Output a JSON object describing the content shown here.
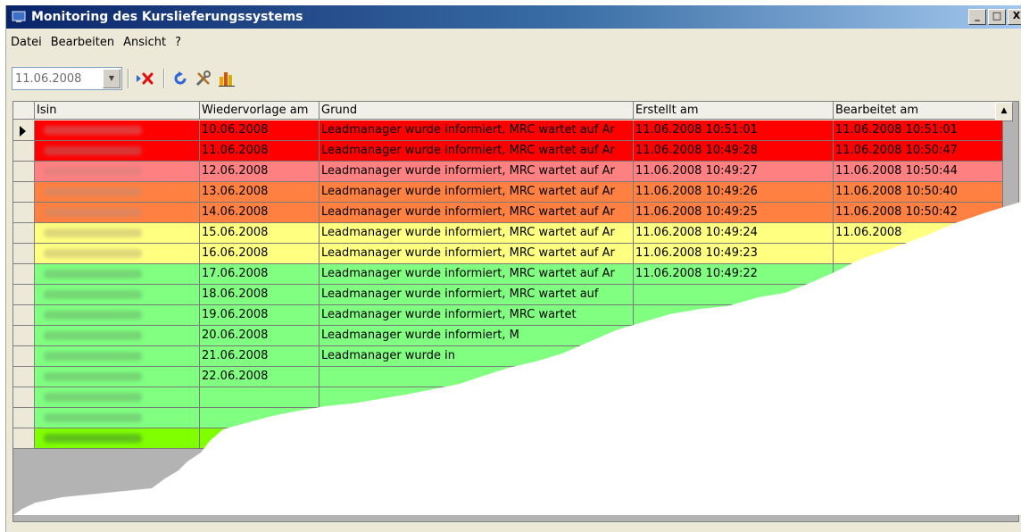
{
  "window": {
    "title": "Monitoring des Kurslieferungssystems",
    "buttons": [
      "_",
      "□",
      "X"
    ]
  },
  "menu": {
    "items": [
      "Datei",
      "Bearbeiten",
      "Ansicht",
      "?"
    ]
  },
  "toolbar": {
    "date_value": "11.06.2008",
    "icons": [
      "delete-red-x-icon",
      "refresh-icon",
      "tools-icon",
      "chart-icon"
    ]
  },
  "grid": {
    "columns": [
      "Isin",
      "Wiedervorlage am",
      "Grund",
      "Erstellt am",
      "Bearbeitet am"
    ],
    "rows": [
      {
        "color": "#ff0000",
        "blur": "#e33a3a",
        "wiedervorlage": "10.06.2008",
        "grund": "Leadmanager wurde informiert, MRC wartet auf Ar",
        "erstellt": "11.06.2008 10:51:01",
        "bearbeitet": "11.06.2008 10:51:01"
      },
      {
        "color": "#ff0000",
        "blur": "#d93636",
        "wiedervorlage": "11.06.2008",
        "grund": "Leadmanager wurde informiert, MRC wartet auf Ar",
        "erstellt": "11.06.2008 10:49:28",
        "bearbeitet": "11.06.2008 10:50:47"
      },
      {
        "color": "#ff8080",
        "blur": "#e88080",
        "wiedervorlage": "12.06.2008",
        "grund": "Leadmanager wurde informiert, MRC wartet auf Ar",
        "erstellt": "11.06.2008 10:49:27",
        "bearbeitet": "11.06.2008 10:50:44"
      },
      {
        "color": "#ff8040",
        "blur": "#e0845a",
        "wiedervorlage": "13.06.2008",
        "grund": "Leadmanager wurde informiert, MRC wartet auf Ar",
        "erstellt": "11.06.2008 10:49:26",
        "bearbeitet": "11.06.2008 10:50:40"
      },
      {
        "color": "#ff8040",
        "blur": "#e0845a",
        "wiedervorlage": "14.06.2008",
        "grund": "Leadmanager wurde informiert, MRC wartet auf Ar",
        "erstellt": "11.06.2008 10:49:25",
        "bearbeitet": "11.06.2008 10:50:42"
      },
      {
        "color": "#ffff80",
        "blur": "#ddd87a",
        "wiedervorlage": "15.06.2008",
        "grund": "Leadmanager wurde informiert, MRC wartet auf Ar",
        "erstellt": "11.06.2008 10:49:24",
        "bearbeitet": "11.06.2008"
      },
      {
        "color": "#ffff80",
        "blur": "#ddd87a",
        "wiedervorlage": "16.06.2008",
        "grund": "Leadmanager wurde informiert, MRC wartet auf Ar",
        "erstellt": "11.06.2008 10:49:23",
        "bearbeitet": ""
      },
      {
        "color": "#80ff80",
        "blur": "#74d674",
        "wiedervorlage": "17.06.2008",
        "grund": "Leadmanager wurde informiert, MRC wartet auf Ar",
        "erstellt": "11.06.2008 10:49:22",
        "bearbeitet": ""
      },
      {
        "color": "#80ff80",
        "blur": "#74d674",
        "wiedervorlage": "18.06.2008",
        "grund": "Leadmanager wurde informiert, MRC wartet auf",
        "erstellt": "",
        "bearbeitet": ""
      },
      {
        "color": "#80ff80",
        "blur": "#74d674",
        "wiedervorlage": "19.06.2008",
        "grund": "Leadmanager wurde informiert, MRC wartet",
        "erstellt": "",
        "bearbeitet": ""
      },
      {
        "color": "#80ff80",
        "blur": "#74d674",
        "wiedervorlage": "20.06.2008",
        "grund": "Leadmanager wurde informiert, M",
        "erstellt": "",
        "bearbeitet": ""
      },
      {
        "color": "#80ff80",
        "blur": "#74d674",
        "wiedervorlage": "21.06.2008",
        "grund": "Leadmanager wurde in",
        "erstellt": "",
        "bearbeitet": ""
      },
      {
        "color": "#80ff80",
        "blur": "#74d674",
        "wiedervorlage": "22.06.2008",
        "grund": "",
        "erstellt": "",
        "bearbeitet": ""
      },
      {
        "color": "#80ff80",
        "blur": "#74d674",
        "wiedervorlage": "",
        "grund": "",
        "erstellt": "",
        "bearbeitet": ""
      },
      {
        "color": "#80ff80",
        "blur": "#74d674",
        "wiedervorlage": "",
        "grund": "",
        "erstellt": "",
        "bearbeitet": ""
      },
      {
        "color": "#80ff00",
        "blur": "#5fc21a",
        "wiedervorlage": "",
        "grund": "",
        "erstellt": "",
        "bearbeitet": ""
      }
    ]
  }
}
